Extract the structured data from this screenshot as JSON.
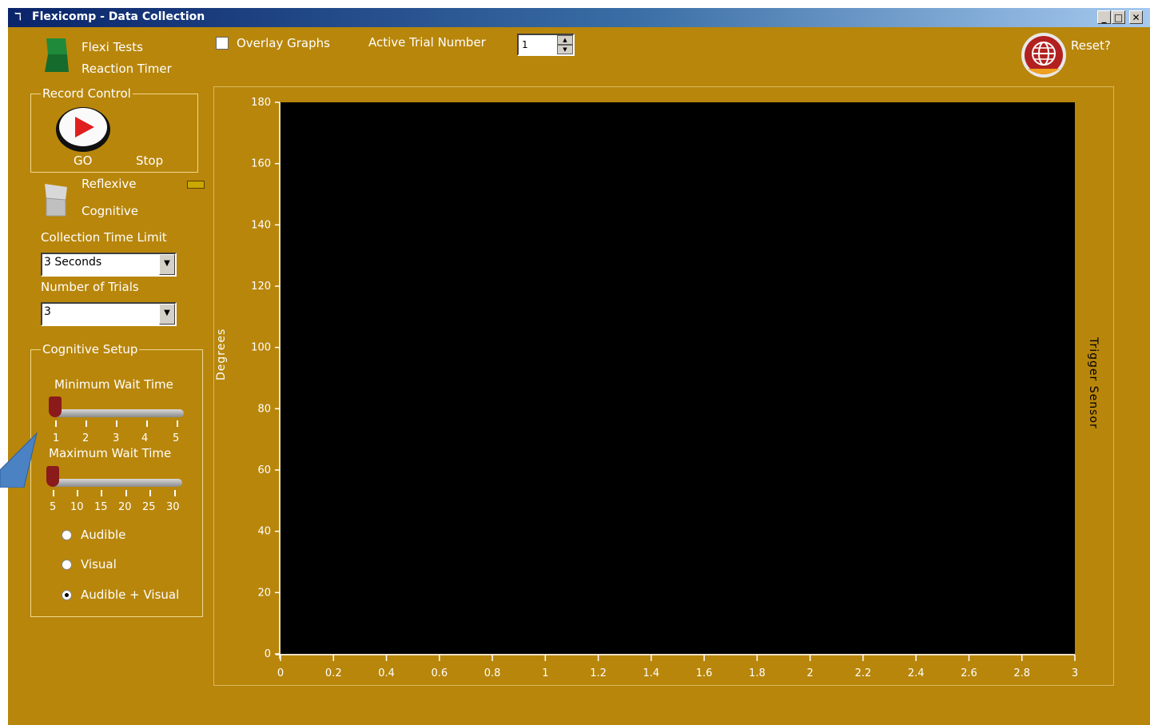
{
  "window": {
    "title": "Flexicomp - Data Collection",
    "minimize": "_",
    "maximize": "□",
    "close": "✕"
  },
  "mode_switch": {
    "upper": "Flexi Tests",
    "lower": "Reaction Timer"
  },
  "overlay": {
    "label": "Overlay Graphs",
    "checked": false
  },
  "active_trial": {
    "label": "Active Trial Number",
    "value": "1"
  },
  "reset": {
    "label": "Reset?"
  },
  "record_control": {
    "title": "Record Control",
    "go": "GO",
    "stop": "Stop"
  },
  "test_type": {
    "upper": "Reflexive",
    "lower": "Cognitive"
  },
  "collection_time": {
    "label": "Collection Time Limit",
    "value": "3 Seconds"
  },
  "num_trials": {
    "label": "Number of Trials",
    "value": "3"
  },
  "cognitive_setup": {
    "title": "Cognitive Setup",
    "min_wait": {
      "label": "Minimum Wait Time",
      "ticks": [
        "1",
        "2",
        "3",
        "4",
        "5"
      ],
      "value": 1
    },
    "max_wait": {
      "label": "Maximum Wait Time",
      "ticks": [
        "5",
        "10",
        "15",
        "20",
        "25",
        "30"
      ],
      "value": 5
    },
    "options": [
      "Audible",
      "Visual",
      "Audible + Visual"
    ],
    "selected": "Audible + Visual"
  },
  "chart_data": {
    "type": "line",
    "ylabel": "Degrees",
    "y2label": "Trigger Sensor",
    "xlim": [
      0,
      3
    ],
    "ylim": [
      0,
      180
    ],
    "x_ticks": [
      "0",
      "0.2",
      "0.4",
      "0.6",
      "0.8",
      "1",
      "1.2",
      "1.4",
      "1.6",
      "1.8",
      "2",
      "2.2",
      "2.4",
      "2.6",
      "2.8",
      "3"
    ],
    "y_ticks": [
      "0",
      "20",
      "40",
      "60",
      "80",
      "100",
      "120",
      "140",
      "160",
      "180"
    ],
    "series": [],
    "plot_bg": "#000000"
  },
  "colors": {
    "panel": "#b8860b",
    "accent_green": "#1f8a3a",
    "thumb": "#8b1a1a"
  }
}
